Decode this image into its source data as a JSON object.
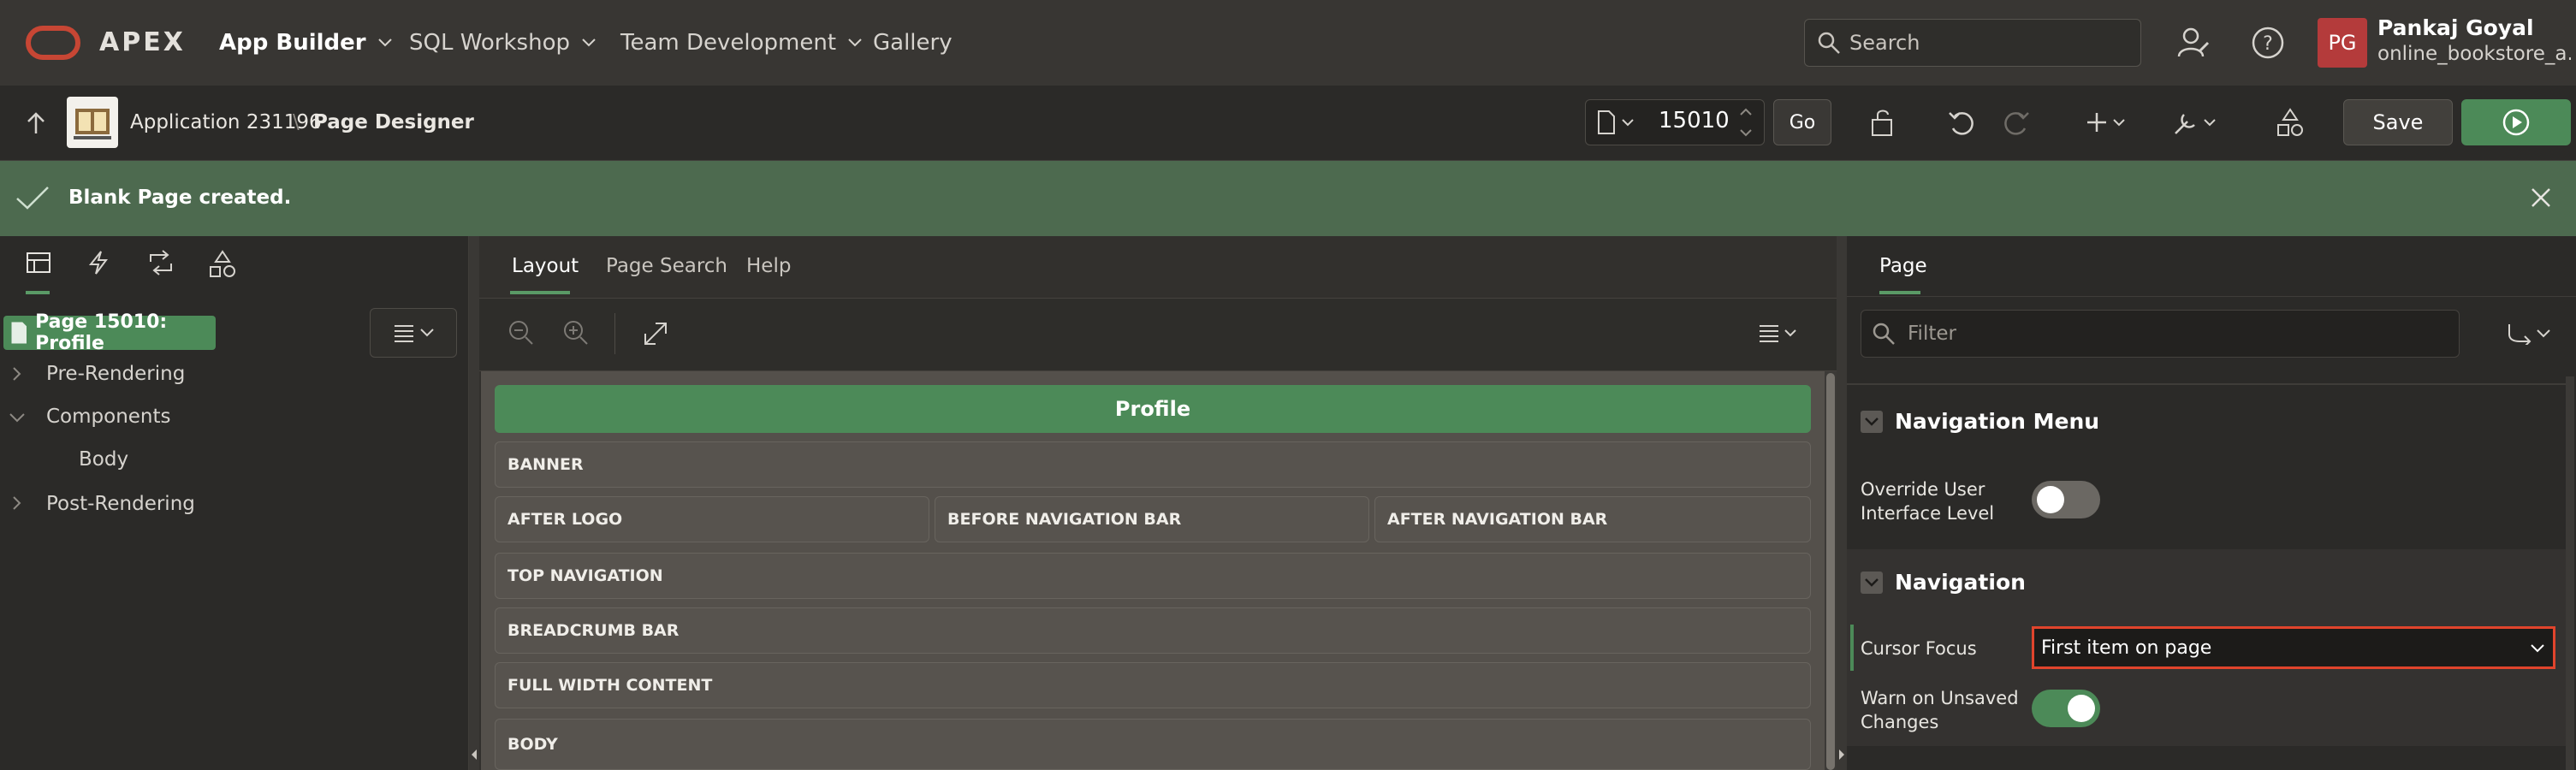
{
  "top_nav": {
    "brand": "APEX",
    "items": [
      {
        "label": "App Builder"
      },
      {
        "label": "SQL Workshop"
      },
      {
        "label": "Team Development"
      },
      {
        "label": "Gallery"
      }
    ],
    "search_placeholder": "Search",
    "user": {
      "initials": "PG",
      "name": "Pankaj Goyal",
      "workspace": "online_bookstore_a..."
    }
  },
  "toolbar": {
    "breadcrumb_app": "Application 231196",
    "breadcrumb_page": "Page Designer",
    "page_number": "15010",
    "go_label": "Go",
    "save_label": "Save"
  },
  "banner": {
    "message": "Blank Page created."
  },
  "left_panel": {
    "tree": {
      "selected": "Page 15010: Profile",
      "nodes": [
        "Pre-Rendering",
        "Components",
        "Body",
        "Post-Rendering"
      ]
    }
  },
  "center_panel": {
    "tabs": [
      "Layout",
      "Page Search",
      "Help"
    ],
    "page_title_region": "Profile",
    "regions": {
      "banner": "BANNER",
      "after_logo": "AFTER LOGO",
      "before_nav_bar": "BEFORE NAVIGATION BAR",
      "after_nav_bar": "AFTER NAVIGATION BAR",
      "top_navigation": "TOP NAVIGATION",
      "breadcrumb_bar": "BREADCRUMB BAR",
      "full_width_content": "FULL WIDTH CONTENT",
      "body": "BODY"
    }
  },
  "right_panel": {
    "tab": "Page",
    "filter_placeholder": "Filter",
    "sections": {
      "navigation_menu": {
        "title": "Navigation Menu",
        "override_label": "Override User Interface Level",
        "override_value": false
      },
      "navigation": {
        "title": "Navigation",
        "cursor_focus_label": "Cursor Focus",
        "cursor_focus_value": "First item on page",
        "warn_label": "Warn on Unsaved Changes",
        "warn_value": true
      }
    }
  },
  "colors": {
    "accent_green": "#4c8a58",
    "banner_green": "#4d6a4f",
    "oracle_red": "#c74634",
    "highlight_red": "#e0442c"
  }
}
